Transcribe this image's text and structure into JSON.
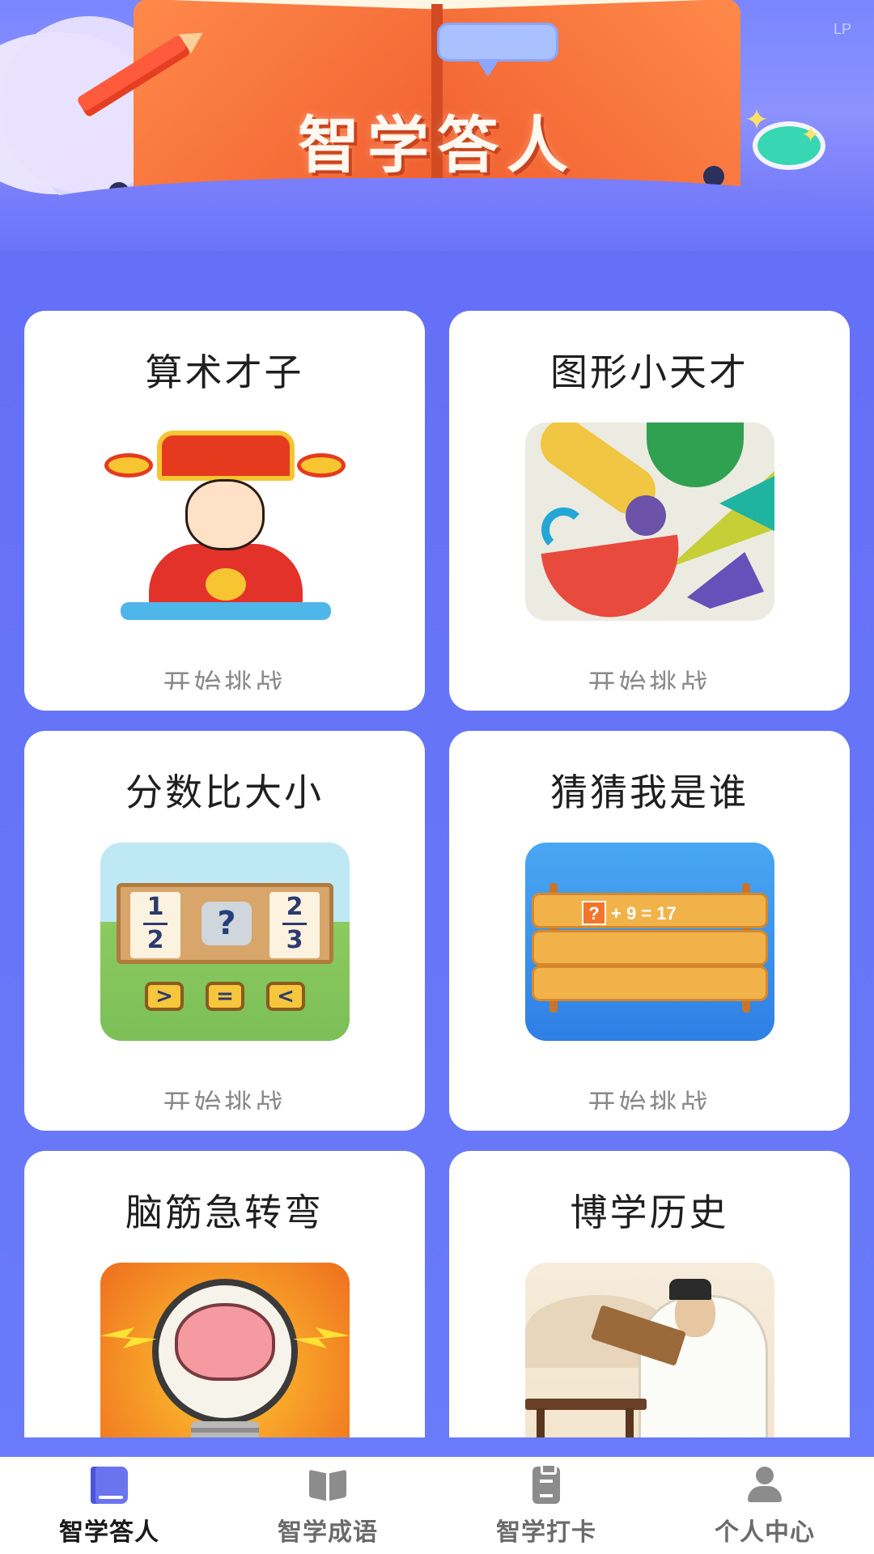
{
  "banner": {
    "title": "智学答人",
    "watermark": "LP"
  },
  "cards": [
    {
      "title": "算术才子",
      "image": "god-of-wealth-illustration",
      "cta": "开始挑战"
    },
    {
      "title": "图形小天才",
      "image": "colorful-shapes-illustration",
      "cta": "开始挑战"
    },
    {
      "title": "分数比大小",
      "image": "fraction-compare-illustration",
      "cta": "开始挑战",
      "thumb_text": {
        "frac_left_num": "1",
        "frac_left_den": "2",
        "frac_mid": "?",
        "frac_right_num": "2",
        "frac_right_den": "3",
        "btn_gt": ">",
        "btn_eq": "=",
        "btn_lt": "<"
      }
    },
    {
      "title": "猜猜我是谁",
      "image": "wooden-sign-equation-illustration",
      "cta": "开始挑战",
      "thumb_text": {
        "q": "?",
        "eq": "+ 9 = 17"
      }
    },
    {
      "title": "脑筋急转弯",
      "image": "brain-lightbulb-illustration"
    },
    {
      "title": "博学历史",
      "image": "ancient-scholar-illustration"
    }
  ],
  "tabbar": {
    "items": [
      {
        "label": "智学答人",
        "icon": "book-icon",
        "active": true,
        "active_color": "#6b74ef"
      },
      {
        "label": "智学成语",
        "icon": "open-book-icon",
        "active": false
      },
      {
        "label": "智学打卡",
        "icon": "clipboard-icon",
        "active": false
      },
      {
        "label": "个人中心",
        "icon": "user-icon",
        "active": false
      }
    ]
  },
  "colors": {
    "background": "#6571f8",
    "card": "#ffffff",
    "title_text": "#1f1f1f",
    "cta_text": "#8a8a8a"
  }
}
